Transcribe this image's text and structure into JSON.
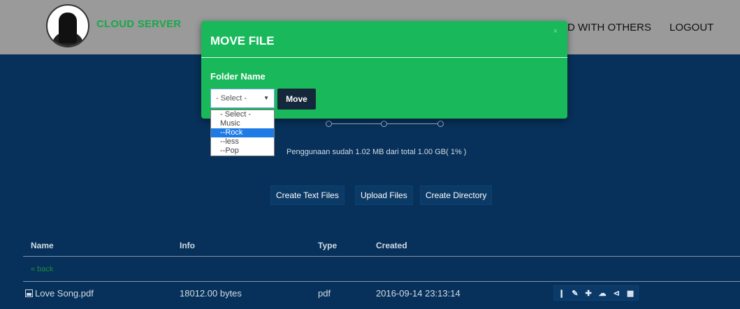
{
  "nav": {
    "brand": "CLOUD SERVER",
    "shared_link": "D WITH OTHERS",
    "logout": "LOGOUT"
  },
  "modal": {
    "title": "MOVE FILE",
    "close": "×",
    "field_label": "Folder Name",
    "selected_value": "- Select -",
    "move_button": "Move",
    "options": [
      "- Select -",
      "Music",
      "--Rock",
      "--less",
      "--Pop"
    ],
    "highlighted_option_index": 2
  },
  "storage": {
    "usage_text": "Penggunaan sudah 1.02 MB dari total 1.00 GB( 1% )"
  },
  "actions": {
    "create_text": "Create Text Files",
    "upload": "Upload Files",
    "create_dir": "Create Directory"
  },
  "table": {
    "headers": [
      "Name",
      "Info",
      "Type",
      "Created"
    ],
    "back": "« back",
    "rows": [
      {
        "name": "Love Song.pdf",
        "info": "18012.00 bytes",
        "type": "pdf",
        "created": "2016-09-14 23:13:14",
        "row_icons": [
          "info-icon",
          "edit-icon",
          "move-icon",
          "cloud-upload-icon",
          "share-icon",
          "trash-icon"
        ]
      }
    ]
  },
  "colors": {
    "modal_green": "#18b85b",
    "background_navy": "#07315a",
    "navbar_gray": "#9a9a9a",
    "brand_green": "#18a94a",
    "selected_blue": "#1e7be6"
  }
}
